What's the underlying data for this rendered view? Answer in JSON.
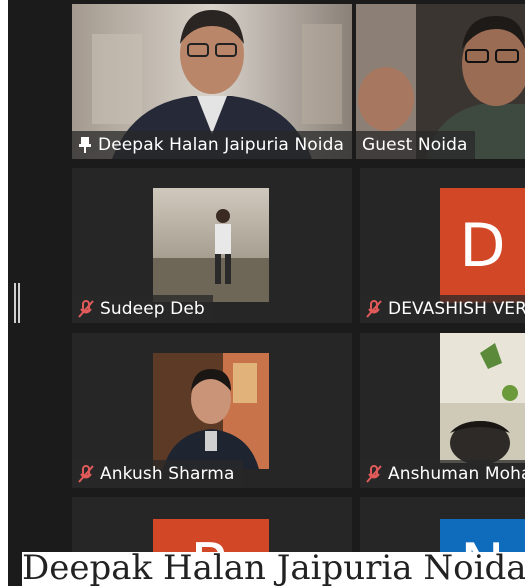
{
  "participants": [
    {
      "name": "Deepak Halan Jaipuria Noida",
      "pinned": true,
      "muted": false,
      "type": "video"
    },
    {
      "name": "Guest Noida",
      "pinned": false,
      "muted": false,
      "type": "video",
      "active_speaker": true
    },
    {
      "name": "Sudeep Deb",
      "pinned": false,
      "muted": true,
      "type": "photo"
    },
    {
      "name": "DEVASHISH VERM",
      "pinned": false,
      "muted": true,
      "type": "avatar",
      "initial": "D",
      "color": "#d24726"
    },
    {
      "name": "Ankush Sharma",
      "pinned": false,
      "muted": true,
      "type": "photo"
    },
    {
      "name": "Anshuman Moha",
      "pinned": false,
      "muted": true,
      "type": "video"
    },
    {
      "name": "",
      "type": "avatar",
      "initial": "R",
      "color": "#d24726"
    },
    {
      "name": "",
      "type": "avatar",
      "initial": "N",
      "color": "#0f6cbd"
    }
  ],
  "caption": {
    "text": "Deepak Halan Jaipuria Noida"
  },
  "colors": {
    "active_border": "#c7d94a",
    "muted_mic": "#e05a5a"
  },
  "icons": {
    "pin": "pin-icon",
    "mic_off": "mic-off-icon"
  }
}
